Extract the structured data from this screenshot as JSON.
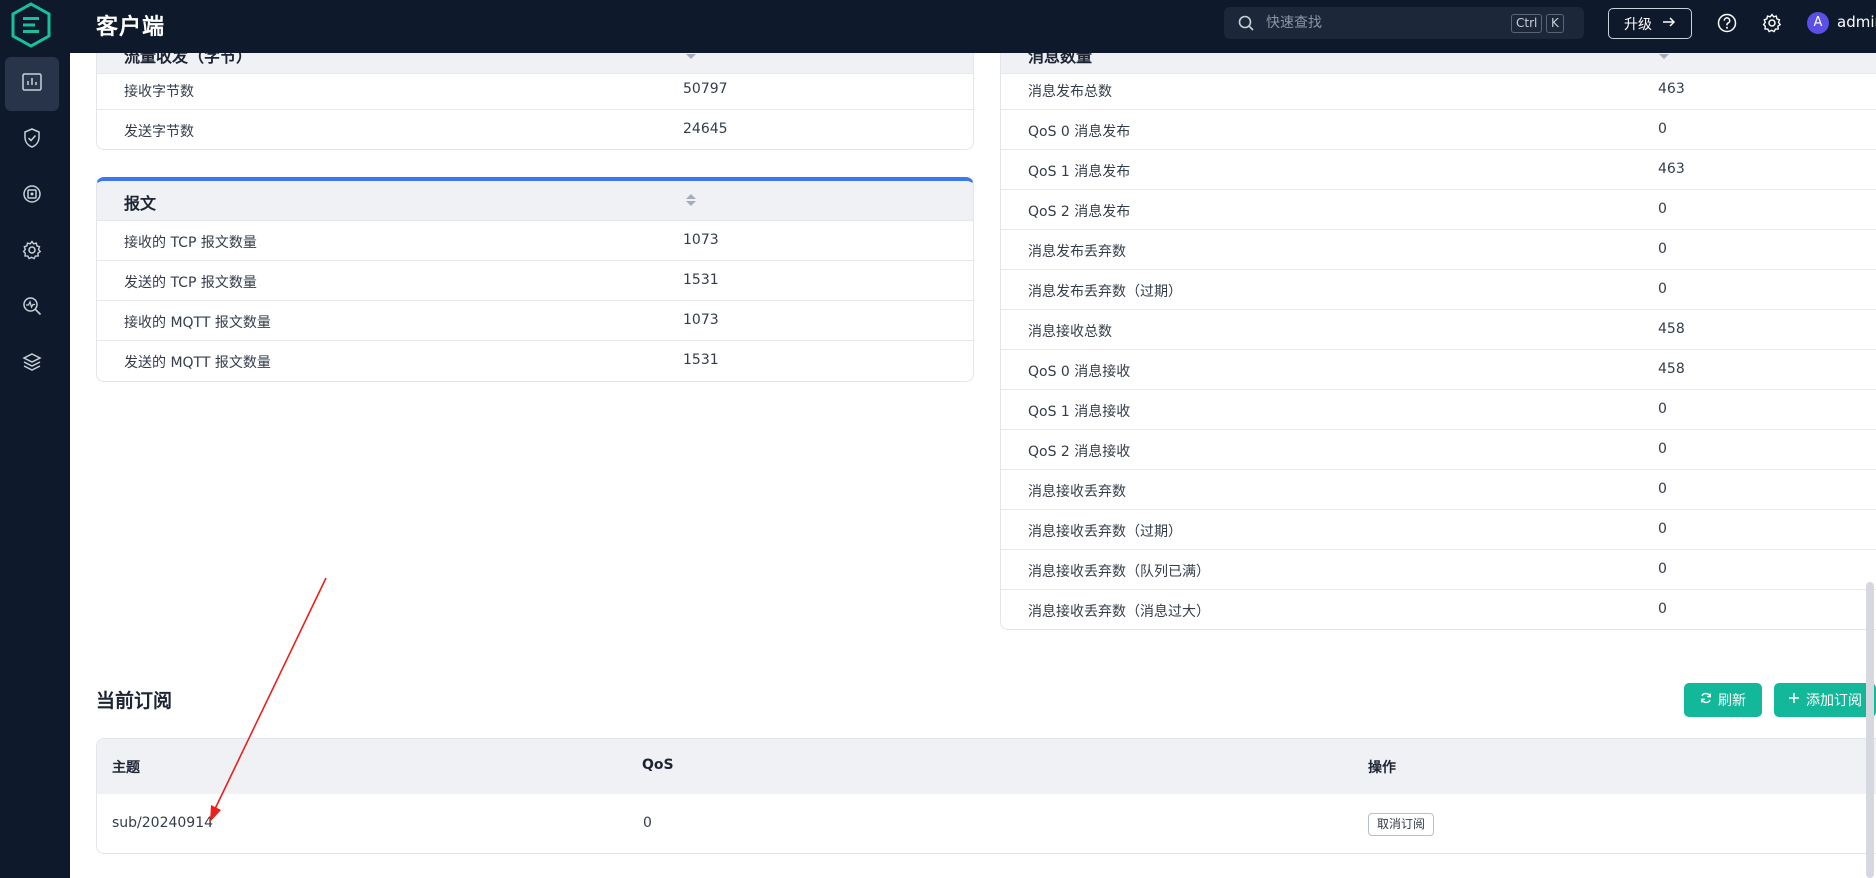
{
  "header": {
    "title": "客户端",
    "search_placeholder": "快速查找",
    "shortcut_ctrl": "Ctrl",
    "shortcut_key": "K",
    "upgrade_label": "升级",
    "user_initial": "A",
    "user_name": "admin"
  },
  "sidebar": {
    "items": [
      {
        "icon": "dashboard-icon",
        "active": true
      },
      {
        "icon": "shield-icon"
      },
      {
        "icon": "integration-icon"
      },
      {
        "icon": "settings-cog-icon"
      },
      {
        "icon": "diagnose-icon"
      },
      {
        "icon": "layers-icon"
      }
    ]
  },
  "traffic_card": {
    "title": "流量收发（字节）",
    "rows": [
      {
        "label": "接收字节数",
        "value": "50797"
      },
      {
        "label": "发送字节数",
        "value": "24645"
      }
    ]
  },
  "packets_card": {
    "title": "报文",
    "rows": [
      {
        "label": "接收的 TCP 报文数量",
        "value": "1073"
      },
      {
        "label": "发送的 TCP 报文数量",
        "value": "1531"
      },
      {
        "label": "接收的 MQTT 报文数量",
        "value": "1073"
      },
      {
        "label": "发送的 MQTT 报文数量",
        "value": "1531"
      }
    ]
  },
  "messages_card": {
    "title": "消息数量",
    "rows": [
      {
        "label": "消息发布总数",
        "value": "463"
      },
      {
        "label": "QoS 0 消息发布",
        "value": "0"
      },
      {
        "label": "QoS 1 消息发布",
        "value": "463"
      },
      {
        "label": "QoS 2 消息发布",
        "value": "0"
      },
      {
        "label": "消息发布丢弃数",
        "value": "0"
      },
      {
        "label": "消息发布丢弃数（过期）",
        "value": "0"
      },
      {
        "label": "消息接收总数",
        "value": "458"
      },
      {
        "label": "QoS 0 消息接收",
        "value": "458"
      },
      {
        "label": "QoS 1 消息接收",
        "value": "0"
      },
      {
        "label": "QoS 2 消息接收",
        "value": "0"
      },
      {
        "label": "消息接收丢弃数",
        "value": "0"
      },
      {
        "label": "消息接收丢弃数（过期）",
        "value": "0"
      },
      {
        "label": "消息接收丢弃数（队列已满）",
        "value": "0"
      },
      {
        "label": "消息接收丢弃数（消息过大）",
        "value": "0"
      }
    ]
  },
  "subscriptions": {
    "title": "当前订阅",
    "refresh_label": "刷新",
    "add_label": "添加订阅",
    "columns": {
      "topic": "主题",
      "qos": "QoS",
      "action": "操作"
    },
    "rows": [
      {
        "topic": "sub/20240914",
        "qos": "0",
        "action": "取消订阅"
      }
    ]
  },
  "colors": {
    "nav_bg": "#0e1a2b",
    "accent_blue": "#3c77f2",
    "accent_green": "#13b89a",
    "annotation_red": "#e8211b"
  }
}
